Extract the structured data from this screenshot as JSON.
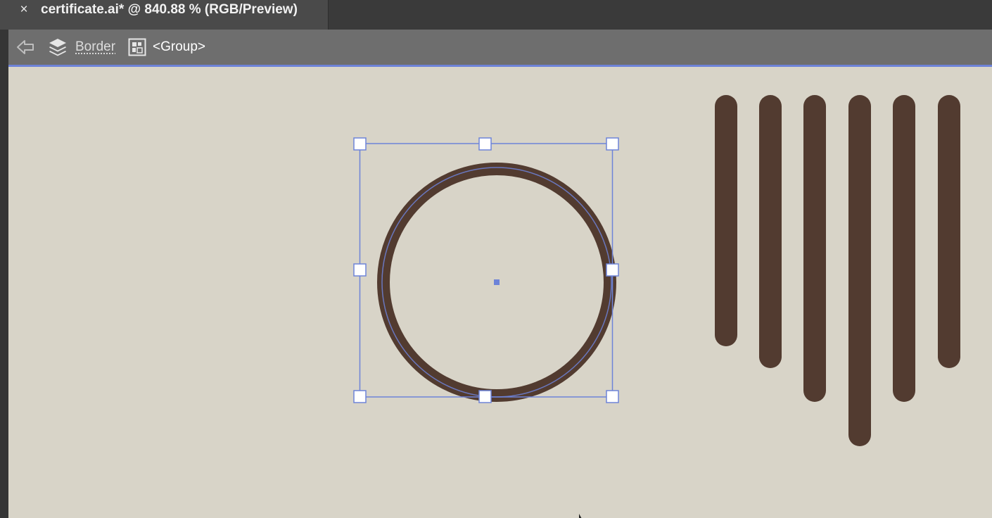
{
  "document_tab": {
    "close_glyph": "×",
    "title": "certificate.ai* @ 840.88 % (RGB/Preview)"
  },
  "isolation_bar": {
    "back_icon": "back-arrow-icon",
    "layer_icon": "layers-icon",
    "layer_name": "Border",
    "group_icon": "group-icon",
    "group_name": "<Group>"
  },
  "colors": {
    "canvas_background": "#d8d4c8",
    "artwork_brown": "#523b30",
    "selection_blue": "#6d83d8",
    "isolation_bar": "#6e6e6e"
  },
  "canvas": {
    "objects": [
      "circle-ring",
      "vertical-bars"
    ],
    "bar_count": 6
  }
}
